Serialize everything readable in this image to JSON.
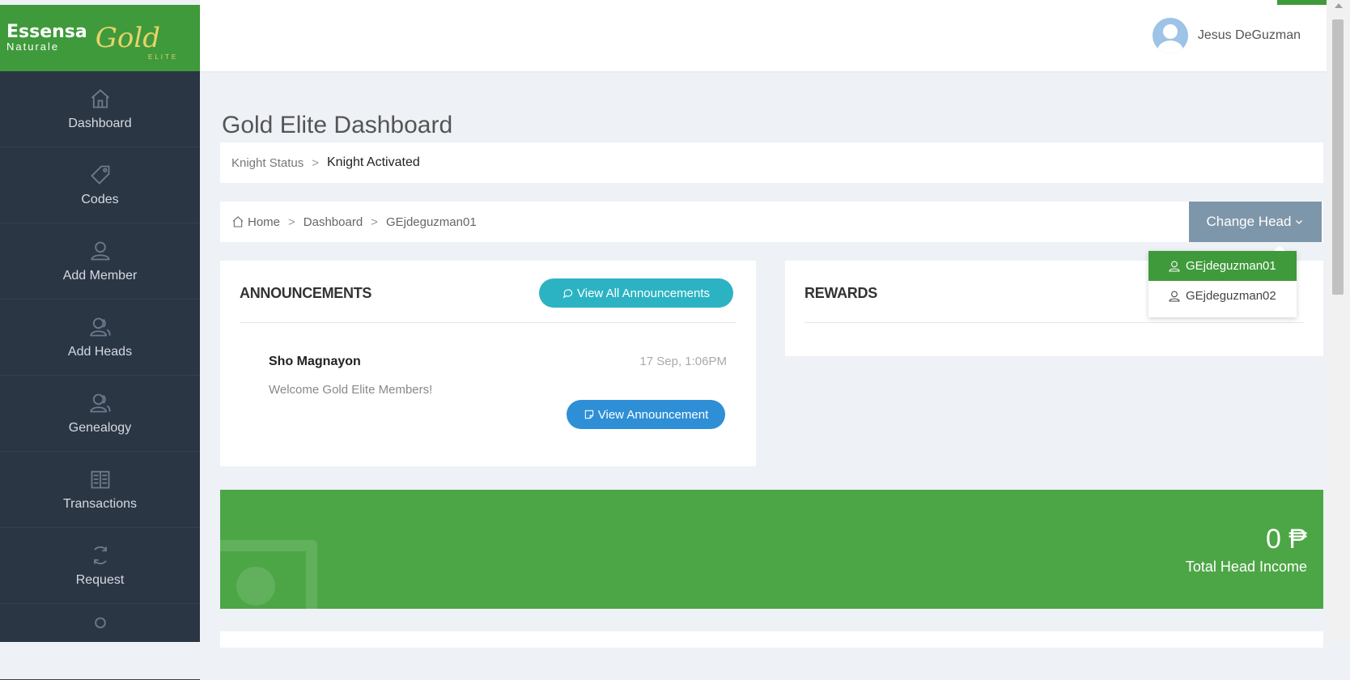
{
  "brand": {
    "name": "Essensa",
    "sub": "Naturale",
    "gold": "Gold",
    "elite": "ELITE"
  },
  "colors": {
    "brand_green": "#3f9a3b",
    "sidebar_bg": "#2b3644",
    "teal_button": "#2cb3c3",
    "blue_button": "#2e8fd6",
    "slate_button": "#7d96a9"
  },
  "sidebar": {
    "items": [
      {
        "label": "Dashboard",
        "icon": "home-icon"
      },
      {
        "label": "Codes",
        "icon": "tag-icon"
      },
      {
        "label": "Add Member",
        "icon": "user-icon"
      },
      {
        "label": "Add Heads",
        "icon": "users-icon"
      },
      {
        "label": "Genealogy",
        "icon": "users-icon"
      },
      {
        "label": "Transactions",
        "icon": "book-icon"
      },
      {
        "label": "Request",
        "icon": "refresh-icon"
      }
    ]
  },
  "header": {
    "user_name": "Jesus DeGuzman"
  },
  "page": {
    "title": "Gold Elite Dashboard"
  },
  "knight": {
    "label": "Knight Status",
    "separator": ">",
    "status": "Knight Activated"
  },
  "breadcrumb": {
    "items": [
      "Home",
      "Dashboard",
      "GEjdeguzman01"
    ],
    "separator": ">"
  },
  "change_head": {
    "label": "Change Head",
    "options": [
      "GEjdeguzman01",
      "GEjdeguzman02"
    ],
    "selected": "GEjdeguzman01"
  },
  "announcements": {
    "title": "ANNOUNCEMENTS",
    "view_all_label": "View All Announcements",
    "item": {
      "author": "Sho Magnayon",
      "date": "17 Sep, 1:06PM",
      "message": "Welcome Gold Elite Members!",
      "view_label": "View Announcement"
    }
  },
  "rewards": {
    "title": "REWARDS"
  },
  "income": {
    "amount": "0 ₱",
    "label": "Total Head Income"
  }
}
